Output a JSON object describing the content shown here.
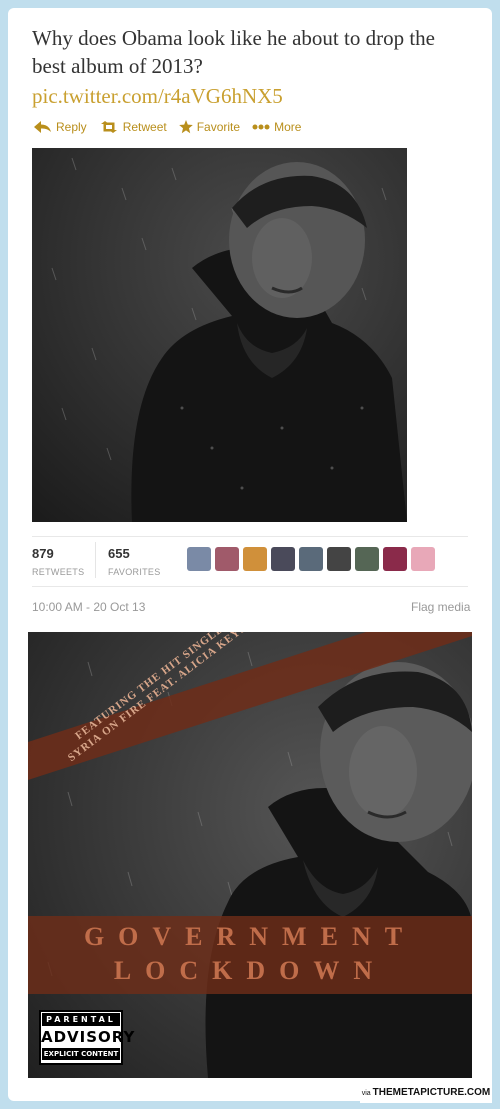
{
  "tweet": {
    "text": "Why does Obama look like he about to drop the best album of 2013?",
    "link": "pic.twitter.com/r4aVG6hNX5"
  },
  "actions": [
    {
      "label": "Reply",
      "icon": "reply-icon"
    },
    {
      "label": "Retweet",
      "icon": "retweet-icon"
    },
    {
      "label": "Favorite",
      "icon": "star-icon"
    },
    {
      "label": "More",
      "icon": "more-icon"
    }
  ],
  "stats": {
    "retweets": {
      "count": "879",
      "label": "RETWEETS"
    },
    "favorites": {
      "count": "655",
      "label": "FAVORITES"
    }
  },
  "avatars_colors": [
    "#7a8aa6",
    "#a05a6a",
    "#d0903a",
    "#4a4a5a",
    "#5a6a7a",
    "#444444",
    "#556655",
    "#8a2a4a",
    "#e8a8b8"
  ],
  "meta": {
    "timestamp": "10:00 AM - 20 Oct 13",
    "flag": "Flag media"
  },
  "cover": {
    "banner_line1": "FEATURING THE HIT SINGLE",
    "banner_line2": "SYRIA ON FIRE FEAT. ALICIA KEYS",
    "title_line1": "GOVERNMENT",
    "title_line2": "LOCKDOWN",
    "advisory_top": "PARENTAL",
    "advisory_mid": "ADVISORY",
    "advisory_bot": "EXPLICIT CONTENT"
  },
  "watermark": {
    "via": "via",
    "site": "THEMETAPICTURE.COM"
  },
  "colors": {
    "background": "#c0deed",
    "link": "#c9a030",
    "action": "#b98f1c",
    "band": "#6e2d19"
  }
}
